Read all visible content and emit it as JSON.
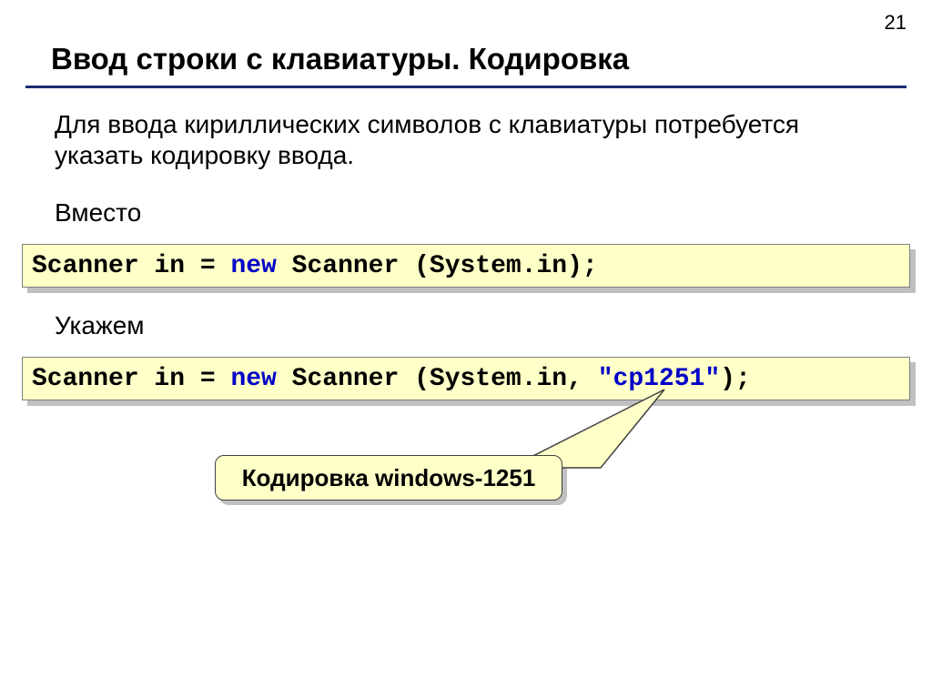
{
  "page_number": "21",
  "title": "Ввод строки с клавиатуры. Кодировка",
  "intro": "Для ввода кириллических символов с клавиатуры потребуется указать кодировку ввода.",
  "sub1": "Вместо",
  "code1": {
    "t1": "Scanner in = ",
    "kw": "new",
    "t2": " Scanner (System.in);"
  },
  "sub2": "Укажем",
  "code2": {
    "t1": "Scanner in = ",
    "kw": "new",
    "t2": " Scanner (System.in, ",
    "str": "\"cp1251\"",
    "t3": ");"
  },
  "callout": "Кодировка windows-1251"
}
